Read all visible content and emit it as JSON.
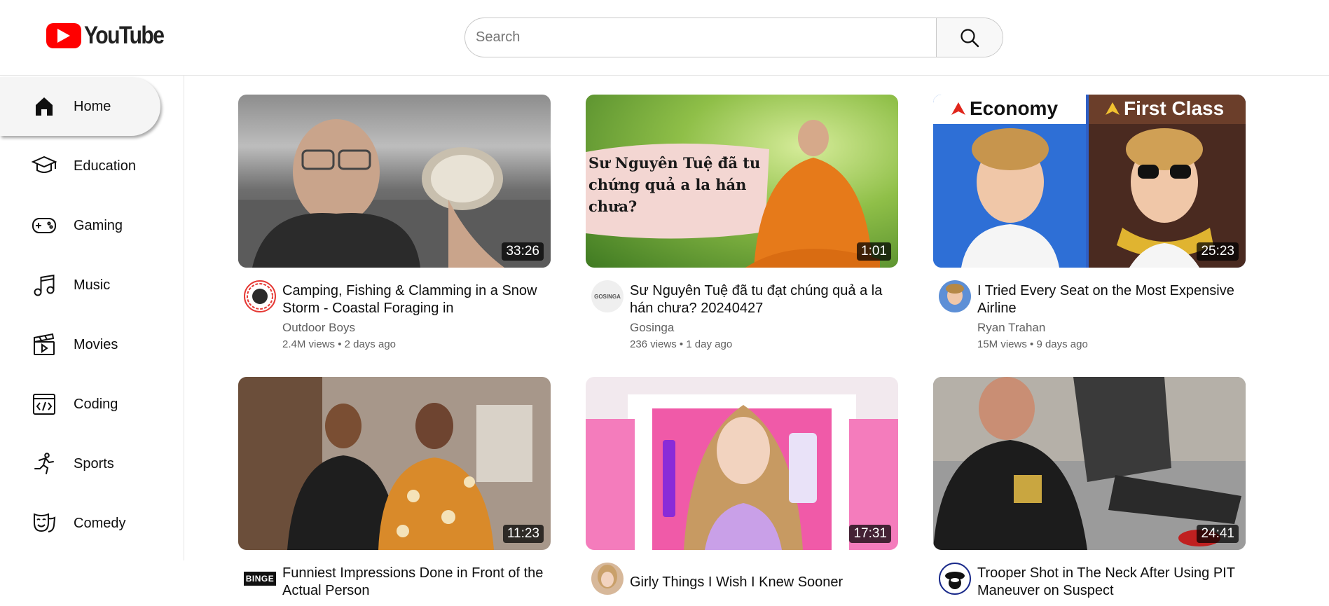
{
  "header": {
    "logo_text": "YouTube",
    "search_placeholder": "Search"
  },
  "sidebar": {
    "items": [
      {
        "label": "Home",
        "icon": "home-icon",
        "active": true
      },
      {
        "label": "Education",
        "icon": "graduation-cap-icon"
      },
      {
        "label": "Gaming",
        "icon": "gamepad-icon"
      },
      {
        "label": "Music",
        "icon": "music-note-icon"
      },
      {
        "label": "Movies",
        "icon": "clapperboard-icon"
      },
      {
        "label": "Coding",
        "icon": "code-window-icon"
      },
      {
        "label": "Sports",
        "icon": "runner-icon"
      },
      {
        "label": "Comedy",
        "icon": "comedy-mask-icon"
      }
    ]
  },
  "videos": [
    {
      "title": "Camping, Fishing & Clamming in a Snow Storm - Coastal Foraging in",
      "channel": "Outdoor Boys",
      "meta": "2.4M views • 2 days ago",
      "duration": "33:26"
    },
    {
      "title": "Sư Nguyên Tuệ đã tu đạt chúng quả a la hán chưa? 20240427",
      "channel": "Gosinga",
      "meta": "236 views • 1 day ago",
      "duration": "1:01",
      "thumb_text": "Sư Nguyên Tuệ đã tu chứng quả a la hán chưa?",
      "avatar_text": "GOSINGA"
    },
    {
      "title": "I Tried Every Seat on the Most Expensive Airline",
      "channel": "Ryan Trahan",
      "meta": "15M views • 9 days ago",
      "duration": "25:23",
      "thumb_left": "Economy",
      "thumb_right": "First Class"
    },
    {
      "title": "Funniest Impressions Done in Front of the Actual Person",
      "duration": "11:23",
      "avatar_text": "BINGE"
    },
    {
      "title": "Girly Things I Wish I Knew Sooner",
      "duration": "17:31"
    },
    {
      "title": "Trooper Shot in The Neck After Using PIT Maneuver on Suspect",
      "duration": "24:41"
    }
  ],
  "colors": {
    "brand_red": "#ff0000",
    "text_primary": "#0f0f0f",
    "text_secondary": "#606060"
  }
}
